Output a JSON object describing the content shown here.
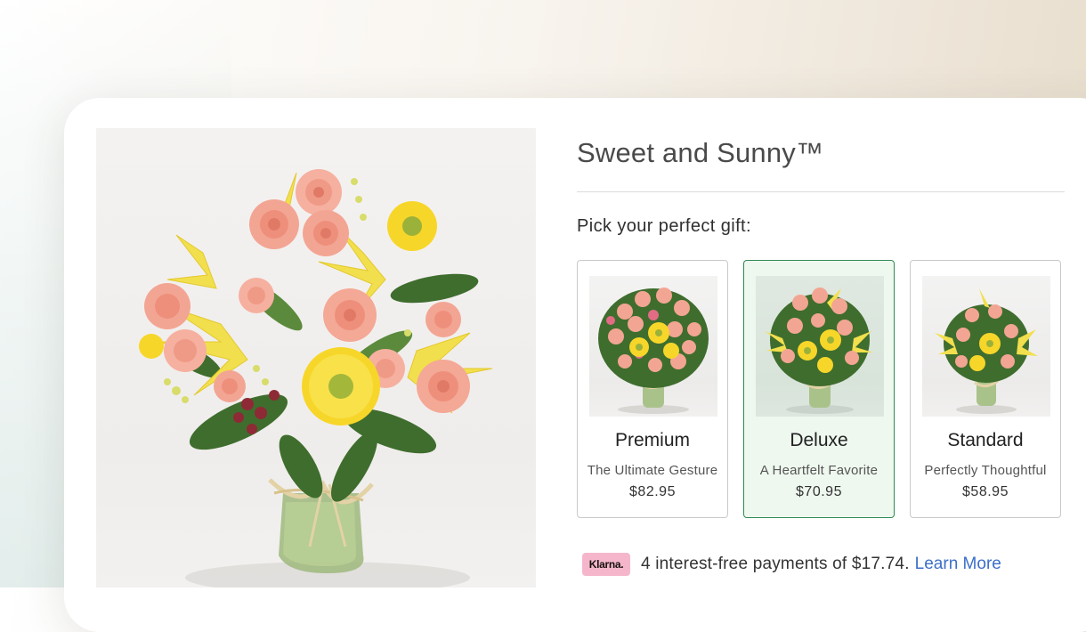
{
  "product": {
    "title": "Sweet and Sunny™"
  },
  "picker": {
    "heading": "Pick your perfect gift:",
    "options": [
      {
        "name": "Premium",
        "subtitle": "The Ultimate Gesture",
        "price": "$82.95",
        "selected": false
      },
      {
        "name": "Deluxe",
        "subtitle": "A Heartfelt Favorite",
        "price": "$70.95",
        "selected": true
      },
      {
        "name": "Standard",
        "subtitle": "Perfectly Thoughtful",
        "price": "$58.95",
        "selected": false
      }
    ]
  },
  "financing": {
    "badge": "Klarna.",
    "text": "4 interest-free payments of $17.74.",
    "link": "Learn More"
  },
  "colors": {
    "selected_border": "#2f8a55",
    "selected_bg": "#eef8ef",
    "link": "#3b6fc9",
    "klarna_badge": "#f5b6cb",
    "rose": "#f3a593",
    "gerbera": "#f7d62a",
    "lily": "#f2df4d",
    "foliage": "#3f6d2e"
  },
  "icons": {
    "klarna": "klarna-logo-badge"
  }
}
